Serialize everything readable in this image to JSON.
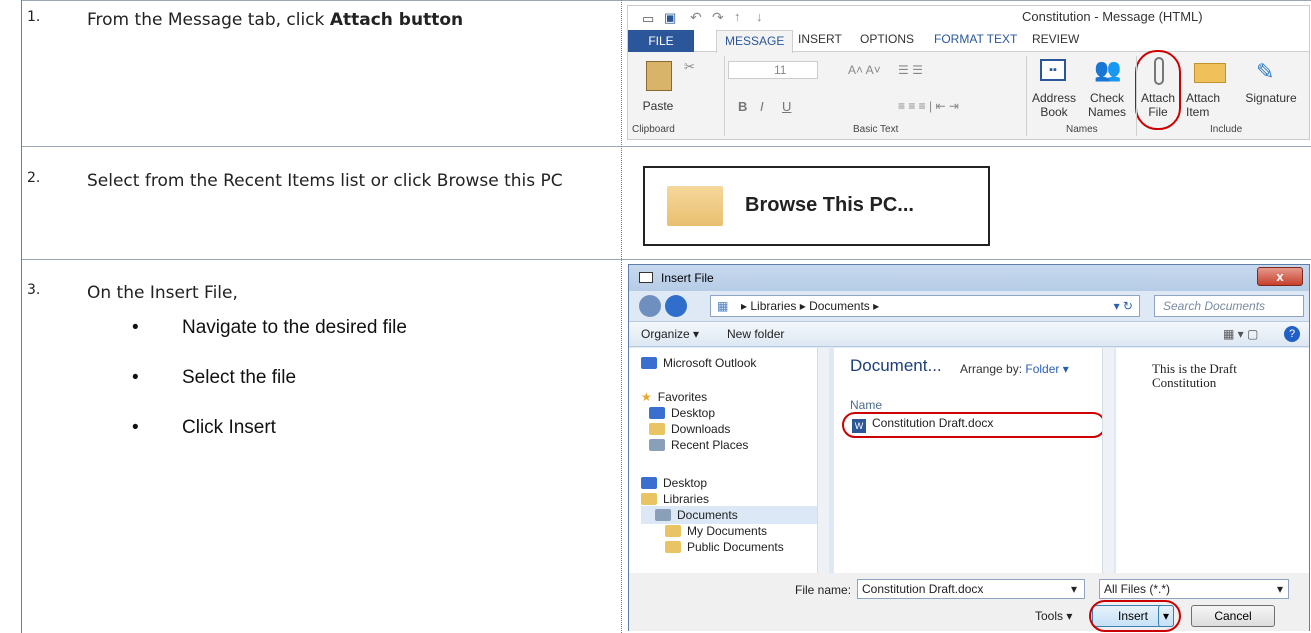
{
  "steps": [
    {
      "number": "1.",
      "text_prefix": "From the Message tab, click ",
      "text_bold": "Attach button"
    },
    {
      "number": "2.",
      "text": "Select from the Recent Items list or click Browse this PC"
    },
    {
      "number": "3.",
      "text": "On the Insert File,",
      "bullets": [
        "Navigate to the desired file",
        "Select the file",
        "Click Insert"
      ]
    }
  ],
  "ribbon": {
    "window_title": "Constitution - Message (HTML)",
    "tabs": [
      "FILE",
      "MESSAGE",
      "INSERT",
      "OPTIONS",
      "FORMAT TEXT",
      "REVIEW"
    ],
    "font_size": "11",
    "paste_label": "Paste",
    "address_book_label": "Address Book",
    "check_names_label": "Check Names",
    "attach_file_label": "Attach File",
    "attach_item_label": "Attach Item",
    "signature_label": "Signature",
    "groups": [
      "Clipboard",
      "Basic Text",
      "Names",
      "Include"
    ],
    "accent": "#2b579a"
  },
  "browse": {
    "label": "Browse This PC..."
  },
  "dialog": {
    "title": "Insert File",
    "close": "x",
    "path": [
      "Libraries",
      "Documents"
    ],
    "search_placeholder": "Search Documents",
    "organize": "Organize",
    "new_folder": "New folder",
    "nav": [
      "Microsoft Outlook",
      "Favorites",
      "Desktop",
      "Downloads",
      "Recent Places",
      "Desktop",
      "Libraries",
      "Documents",
      "My Documents",
      "Public Documents"
    ],
    "list_header": "Document...",
    "arrange_label": "Arrange by:",
    "arrange_value": "Folder",
    "column_name": "Name",
    "file": "Constitution Draft.docx",
    "preview": "This is the Draft Constitution",
    "file_name_label": "File name:",
    "file_name_value": "Constitution Draft.docx",
    "filter": "All Files (*.*)",
    "tools": "Tools",
    "insert": "Insert",
    "cancel": "Cancel"
  }
}
